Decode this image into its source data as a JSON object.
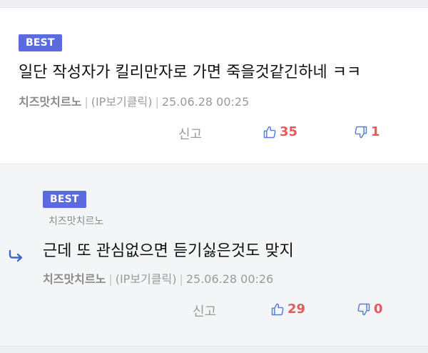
{
  "comments": [
    {
      "badge": "BEST",
      "text": "일단 작성자가 킬리만자로 가면 죽을것같긴하네 ㅋㅋ",
      "author": "치즈맛치르노",
      "ip": "(IP보기클릭)",
      "date": "25.06.28 00:25",
      "report": "신고",
      "likes": "35",
      "dislikes": "1"
    },
    {
      "badge": "BEST",
      "reply_to": "치즈맛치르노",
      "text": "근데 또 관심없으면 듣기싫은것도 맞지",
      "author": "치즈맛치르노",
      "ip": "(IP보기클릭)",
      "date": "25.06.28 00:26",
      "report": "신고",
      "likes": "29",
      "dislikes": "0"
    }
  ],
  "colors": {
    "badge": "#5b6bdf",
    "icon_blue": "#5b7fd6",
    "count_red": "#e35a5a"
  },
  "icons": [
    "thumbs-up-icon",
    "thumbs-down-icon",
    "reply-arrow-icon"
  ]
}
